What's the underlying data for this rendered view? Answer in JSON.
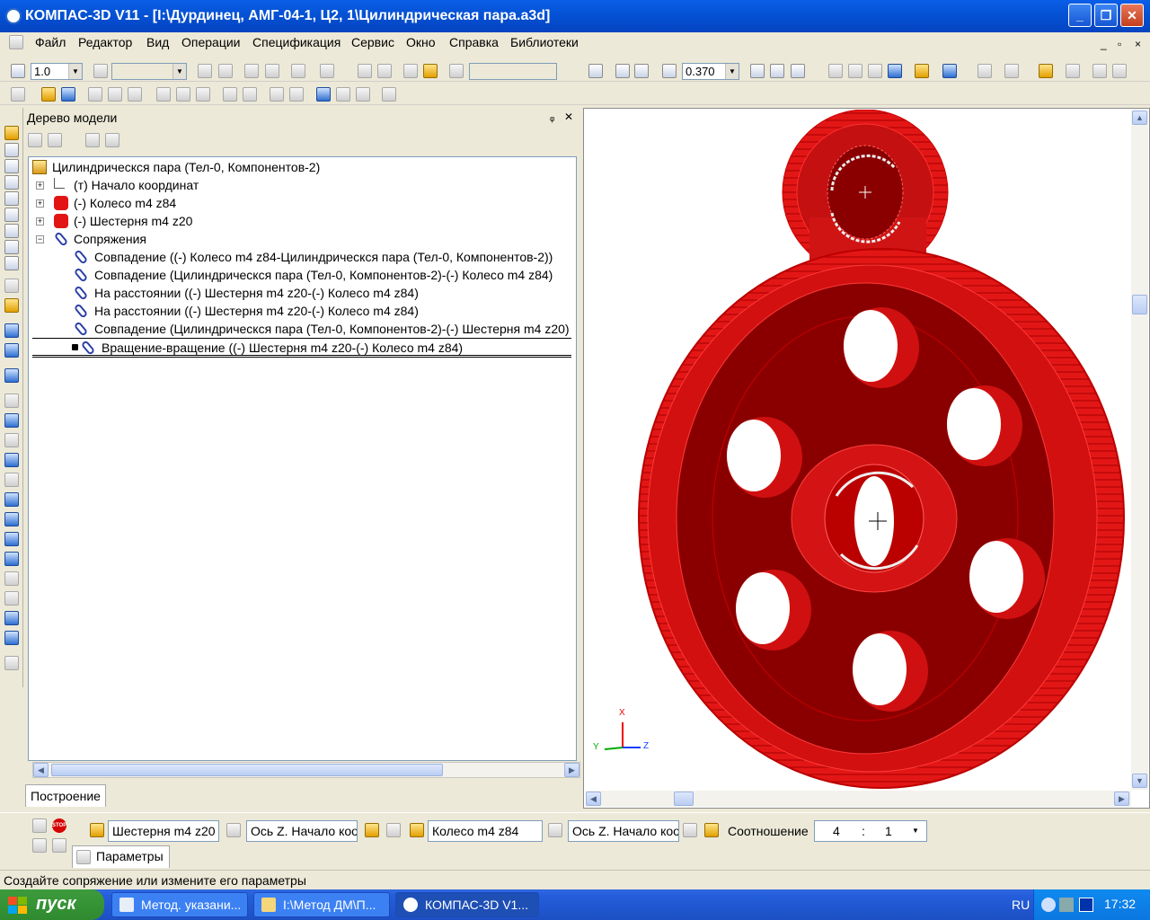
{
  "window": {
    "title": "КОМПАС-3D V11 - [I:\\Дурдинец, АМГ-04-1, Ц2, 1\\Цилиндрическая пара.a3d]",
    "minimize": "_",
    "maximize": "❐",
    "close": "✕"
  },
  "menu": {
    "items": [
      "Файл",
      "Редактор",
      "Вид",
      "Операции",
      "Спецификация",
      "Сервис",
      "Окно",
      "Справка",
      "Библиотеки"
    ],
    "mdi_minimize": "_",
    "mdi_restore": "▫",
    "mdi_close": "×"
  },
  "toolbar": {
    "step_value": "1.0",
    "zoom_value": "0.370"
  },
  "tree_panel": {
    "title": "Дерево модели",
    "pin": "ᵩ",
    "close": "✕",
    "root": "Цилиндрическся пара (Тел-0, Компонентов-2)",
    "items": [
      {
        "label": "(т) Начало координат",
        "expander": "+"
      },
      {
        "label": "(-) Колесо m4 z84",
        "expander": "+"
      },
      {
        "label": "(-) Шестерня m4 z20",
        "expander": "+"
      },
      {
        "label": "Сопряжения",
        "expander": "−"
      }
    ],
    "mates": [
      "Совпадение ((-) Колесо m4 z84-Цилиндрическся пара (Тел-0, Компонентов-2))",
      "Совпадение (Цилиндрическся пара (Тел-0, Компонентов-2)-(-) Колесо m4 z84)",
      "На расстоянии ((-) Шестерня m4 z20-(-) Колесо m4 z84)",
      "На расстоянии ((-) Шестерня m4 z20-(-) Колесо m4 z84)",
      "Совпадение (Цилиндрическся пара (Тел-0, Компонентов-2)-(-) Шестерня m4 z20)",
      "Вращение-вращение ((-) Шестерня m4 z20-(-) Колесо m4 z84)"
    ],
    "tab": "Построение"
  },
  "viewport": {
    "axis_x": "X",
    "axis_y": "Y",
    "axis_z": "Z",
    "colors": {
      "gear": "#e01010",
      "gear_dark": "#8a0000"
    }
  },
  "properties": {
    "part1": "Шестерня m4 z20",
    "axis1": "Ось Z. Начало коо",
    "part2": "Колесо m4 z84",
    "axis2": "Ось Z. Начало коо",
    "ratio_label": "Соотношение",
    "ratio_a": "4",
    "ratio_sep": ":",
    "ratio_b": "1",
    "tab": "Параметры",
    "stop": "STOP"
  },
  "status": {
    "text": "Создайте сопряжение или измените его параметры"
  },
  "taskbar": {
    "start": "пуск",
    "tasks": [
      "Метод. указани...",
      "I:\\Метод ДМ\\П...",
      "КОМПАС-3D V1..."
    ],
    "lang": "RU",
    "clock": "17:32"
  }
}
